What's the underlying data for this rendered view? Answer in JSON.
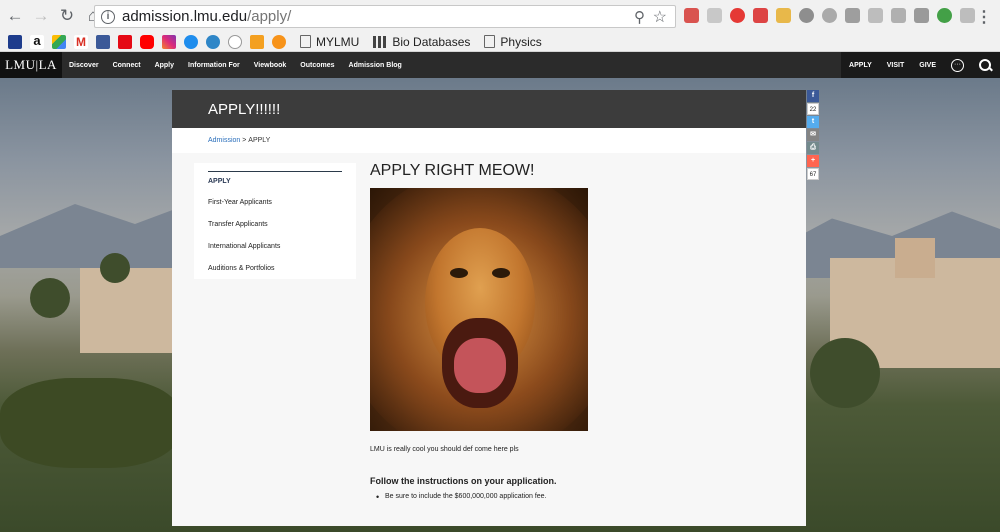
{
  "browser": {
    "url_host": "admission.lmu.edu",
    "url_path": "/apply/",
    "bookmarks": [
      {
        "label": "MYLMU"
      },
      {
        "label": "Bio Databases"
      },
      {
        "label": "Physics"
      }
    ]
  },
  "site_nav": {
    "logo": "LMU|LA",
    "links": [
      "Discover",
      "Connect",
      "Apply",
      "Information For",
      "Viewbook",
      "Outcomes",
      "Admission Blog"
    ],
    "right_links": [
      "APPLY",
      "VISIT",
      "GIVE"
    ]
  },
  "page": {
    "header": "APPLY!!!!!!",
    "breadcrumb": {
      "link": "Admission",
      "separator": " > ",
      "current": "APPLY"
    },
    "sidebar": [
      "APPLY",
      "First-Year Applicants",
      "Transfer Applicants",
      "International Applicants",
      "Auditions & Portfolios"
    ],
    "title": "APPLY RIGHT MEOW!",
    "intro": "LMU is really cool you should def come here pls",
    "instructions_heading": "Follow the instructions on your application.",
    "bullets": [
      "Be sure to include the $600,000,000 application fee."
    ]
  },
  "share": {
    "facebook_count": "22",
    "total_count": "67"
  },
  "colors": {
    "nav_bg": "#2b2b2b",
    "panel_header": "#3c3c3c",
    "link": "#2a6ebb",
    "facebook": "#3b5998",
    "twitter": "#55acee",
    "email": "#848484",
    "print": "#738a8d",
    "more": "#ff6550"
  }
}
